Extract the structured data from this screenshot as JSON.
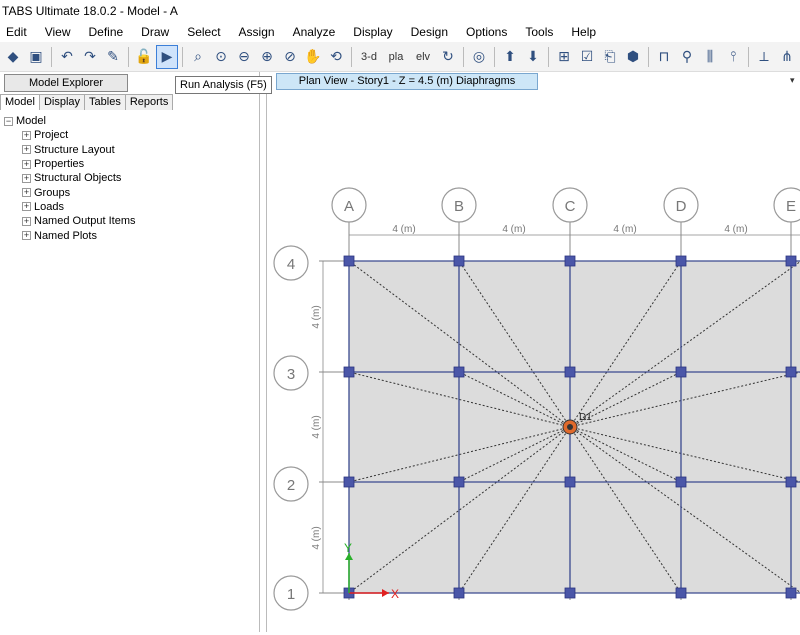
{
  "app": {
    "title": "TABS Ultimate 18.0.2 - Model - A"
  },
  "menu": [
    "Edit",
    "View",
    "Define",
    "Draw",
    "Select",
    "Assign",
    "Analyze",
    "Display",
    "Design",
    "Options",
    "Tools",
    "Help"
  ],
  "toolbar": {
    "tooltip": "Run Analysis (F5)",
    "view3d_label": "3-d",
    "plan_label": "pla",
    "elev_label": "elv"
  },
  "explorer": {
    "title": "Model Explorer",
    "tabs": [
      "Model",
      "Display",
      "Tables",
      "Reports"
    ],
    "root": "Model",
    "items": [
      "Project",
      "Structure Layout",
      "Properties",
      "Structural Objects",
      "Groups",
      "Loads",
      "Named Output Items",
      "Named Plots"
    ]
  },
  "view": {
    "tab_label": "Plan View - Story1 - Z = 4.5 (m)  Diaphragms",
    "grid_x_labels": [
      "A",
      "B",
      "C",
      "D",
      "E"
    ],
    "grid_y_labels": [
      "4",
      "3",
      "2",
      "1"
    ],
    "x_dims": [
      "4 (m)",
      "4 (m)",
      "4 (m)",
      "4 (m)"
    ],
    "y_dims": [
      "4 (m)",
      "4 (m)",
      "4 (m)"
    ],
    "diaphragm_label": "D1",
    "axis_x": "X",
    "axis_y": "Y"
  }
}
